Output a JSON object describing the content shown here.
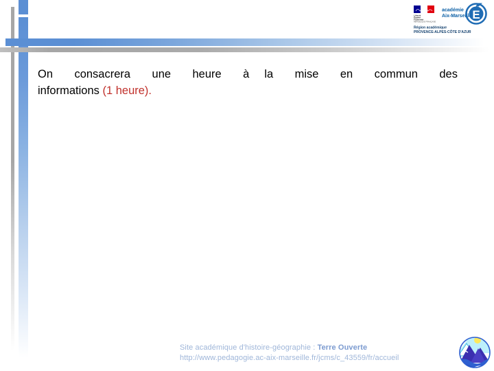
{
  "slide": {
    "background_color": "#ffffff",
    "accent_blue": "#5b8fd4",
    "accent_grey": "#a6a6a6",
    "accent_red": "#c0302b",
    "footer_color": "#9fb6d9"
  },
  "header": {
    "logo": {
      "marianne_motto_line1": "Liberté",
      "marianne_motto_line2": "Égalité",
      "marianne_motto_line3": "Fraternité",
      "academy_line1": "académie",
      "academy_line2": "Aix-Marseille",
      "emblem_letter": "É",
      "region_line1": "Région académique",
      "region_line2": "PROVENCE-ALPES-CÔTE D'AZUR"
    }
  },
  "body": {
    "line1_main": "On consacrera une heure à",
    "line1_tail": "la mise en commun des",
    "line2_prefix": "informations ",
    "line2_highlight": "(1 heure)."
  },
  "footer": {
    "site_label": "Site académique d'histoire-géographie : ",
    "site_name": "Terre Ouverte",
    "url": "http://www.pedagogie.ac-aix-marseille.fr/jcms/c_43559/fr/accueil"
  }
}
